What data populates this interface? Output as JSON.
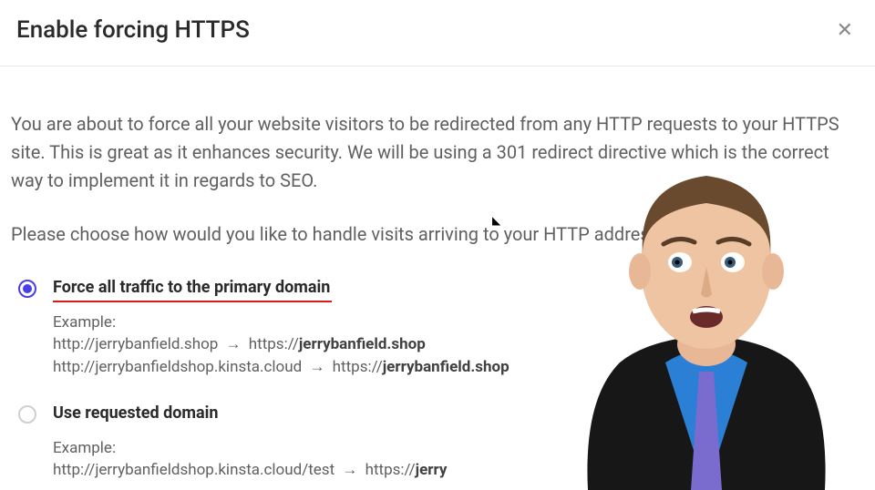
{
  "header": {
    "title": "Enable forcing HTTPS",
    "close_label": "✕"
  },
  "description": "You are about to force all your website visitors to be redirected from any HTTP requests to your HTTPS site. This is great as it enhances security. We will be using a 301 redirect directive which is the correct way to implement it in regards to SEO.",
  "prompt": "Please choose how would you like to handle visits arriving to your HTTP address.",
  "option1": {
    "label": "Force all traffic to the primary domain",
    "example_label": "Example:",
    "ex1_from": "http://jerrybanfield.shop",
    "ex1_to_prefix": "https://",
    "ex1_to_bold": "jerrybanfield.shop",
    "ex2_from": "http://jerrybanfieldshop.kinsta.cloud",
    "ex2_to_prefix": "https://",
    "ex2_to_bold": "jerrybanfield.shop"
  },
  "option2": {
    "label": "Use requested domain",
    "example_label": "Example:",
    "ex1_from": "http://jerrybanfieldshop.kinsta.cloud/test",
    "ex1_to_prefix": "https://",
    "ex1_to_bold": "jerry"
  },
  "arrow": "→"
}
